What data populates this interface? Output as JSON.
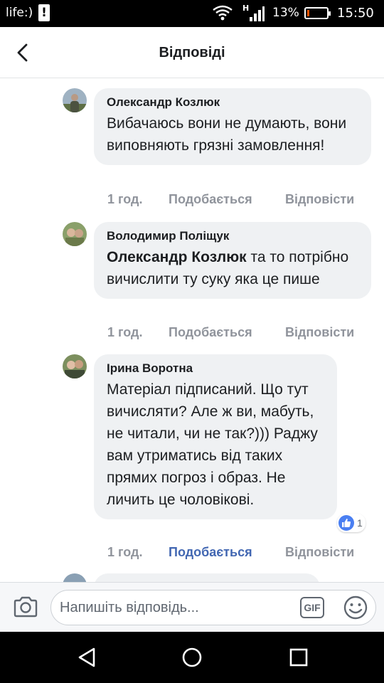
{
  "status_bar": {
    "carrier": "life:)",
    "alert": "!",
    "network": "H",
    "battery_pct": "13%",
    "battery_level": 0.13,
    "time": "15:50"
  },
  "header": {
    "title": "Відповіді"
  },
  "comments": [
    {
      "author": "Олександр Козлюк",
      "text": "Вибачаюсь вони не думають, вони виповняють      грязні замовлення!",
      "time": "1 год.",
      "like_label": "Подобається",
      "reply_label": "Відповісти",
      "liked": false
    },
    {
      "author": "Володимир Поліщук",
      "mention": "Олександр Козлюк",
      "text": " та то потрібно вичислити ту суку яка це пише",
      "time": "1 год.",
      "like_label": "Подобається",
      "reply_label": "Відповісти",
      "liked": false
    },
    {
      "author": "Ірина Воротна",
      "text": "Матеріал підписаний. Що тут вичисляти? Але ж ви, мабуть, не читали, чи не так?))) Раджу вам утриматись від таких прямих погроз і образ. Не личить це чоловікові.",
      "time": "1 год.",
      "like_label": "Подобається",
      "reply_label": "Відповісти",
      "liked": true,
      "reaction_count": "1"
    }
  ],
  "composer": {
    "placeholder": "Напишіть відповідь...",
    "gif_label": "GIF"
  },
  "colors": {
    "accent": "#4267b2",
    "bubble": "#eff1f3",
    "meta": "#90949c",
    "like_reaction": "#4a7ff2"
  },
  "icons": [
    "back-arrow-icon",
    "wifi-icon",
    "signal-icon",
    "battery-icon",
    "camera-icon",
    "emoji-icon",
    "like-icon",
    "nav-back-icon",
    "nav-home-icon",
    "nav-recents-icon"
  ]
}
